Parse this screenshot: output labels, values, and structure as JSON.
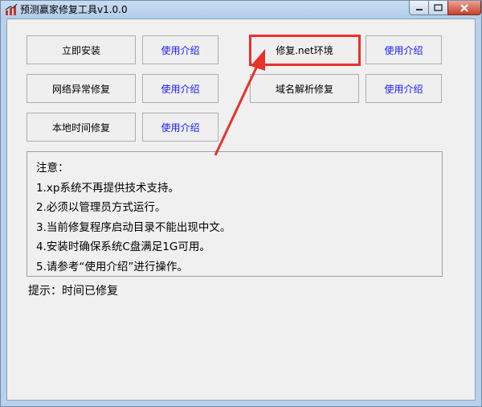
{
  "window": {
    "title": "预测赢家修复工具v1.0.0"
  },
  "buttons": {
    "install": "立即安装",
    "network_repair": "网络异常修复",
    "local_time_repair": "本地时间修复",
    "net_repair": "修复.net环境",
    "dns_repair": "域名解析修复",
    "help_label": "使用介绍"
  },
  "notes": {
    "heading": "注意：",
    "lines": [
      "1.xp系统不再提供技术支持。",
      "2.必须以管理员方式运行。",
      "3.当前修复程序启动目录不能出现中文。",
      "4.安装时确保系统C盘满足1G可用。",
      "5.请参考“使用介绍”进行操作。"
    ]
  },
  "status": {
    "hint": "提示：时间已修复"
  },
  "colors": {
    "highlight": "#e8312a",
    "help_link": "#1a1aff"
  }
}
